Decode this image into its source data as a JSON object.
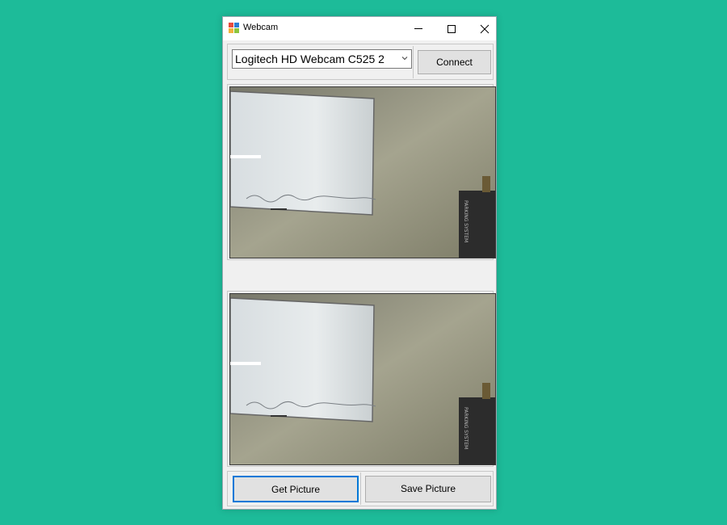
{
  "window": {
    "title": "Webcam",
    "icon": "app-form-icon"
  },
  "titlebar_buttons": [
    "minimize-icon",
    "maximize-icon",
    "close-icon"
  ],
  "device_select": {
    "selected": "Logitech HD Webcam C525 2"
  },
  "connect_button": {
    "label": "Connect"
  },
  "live_feed": {
    "content": "webcam view of whiteboard on wall"
  },
  "captured_picture": {
    "content": "captured snapshot of whiteboard on wall"
  },
  "actions": {
    "get_picture": "Get Picture",
    "save_picture": "Save Picture"
  },
  "colors": {
    "desktop": "#1dbb99",
    "window_bg": "#f0f0f0",
    "focus_border": "#0078d7"
  }
}
